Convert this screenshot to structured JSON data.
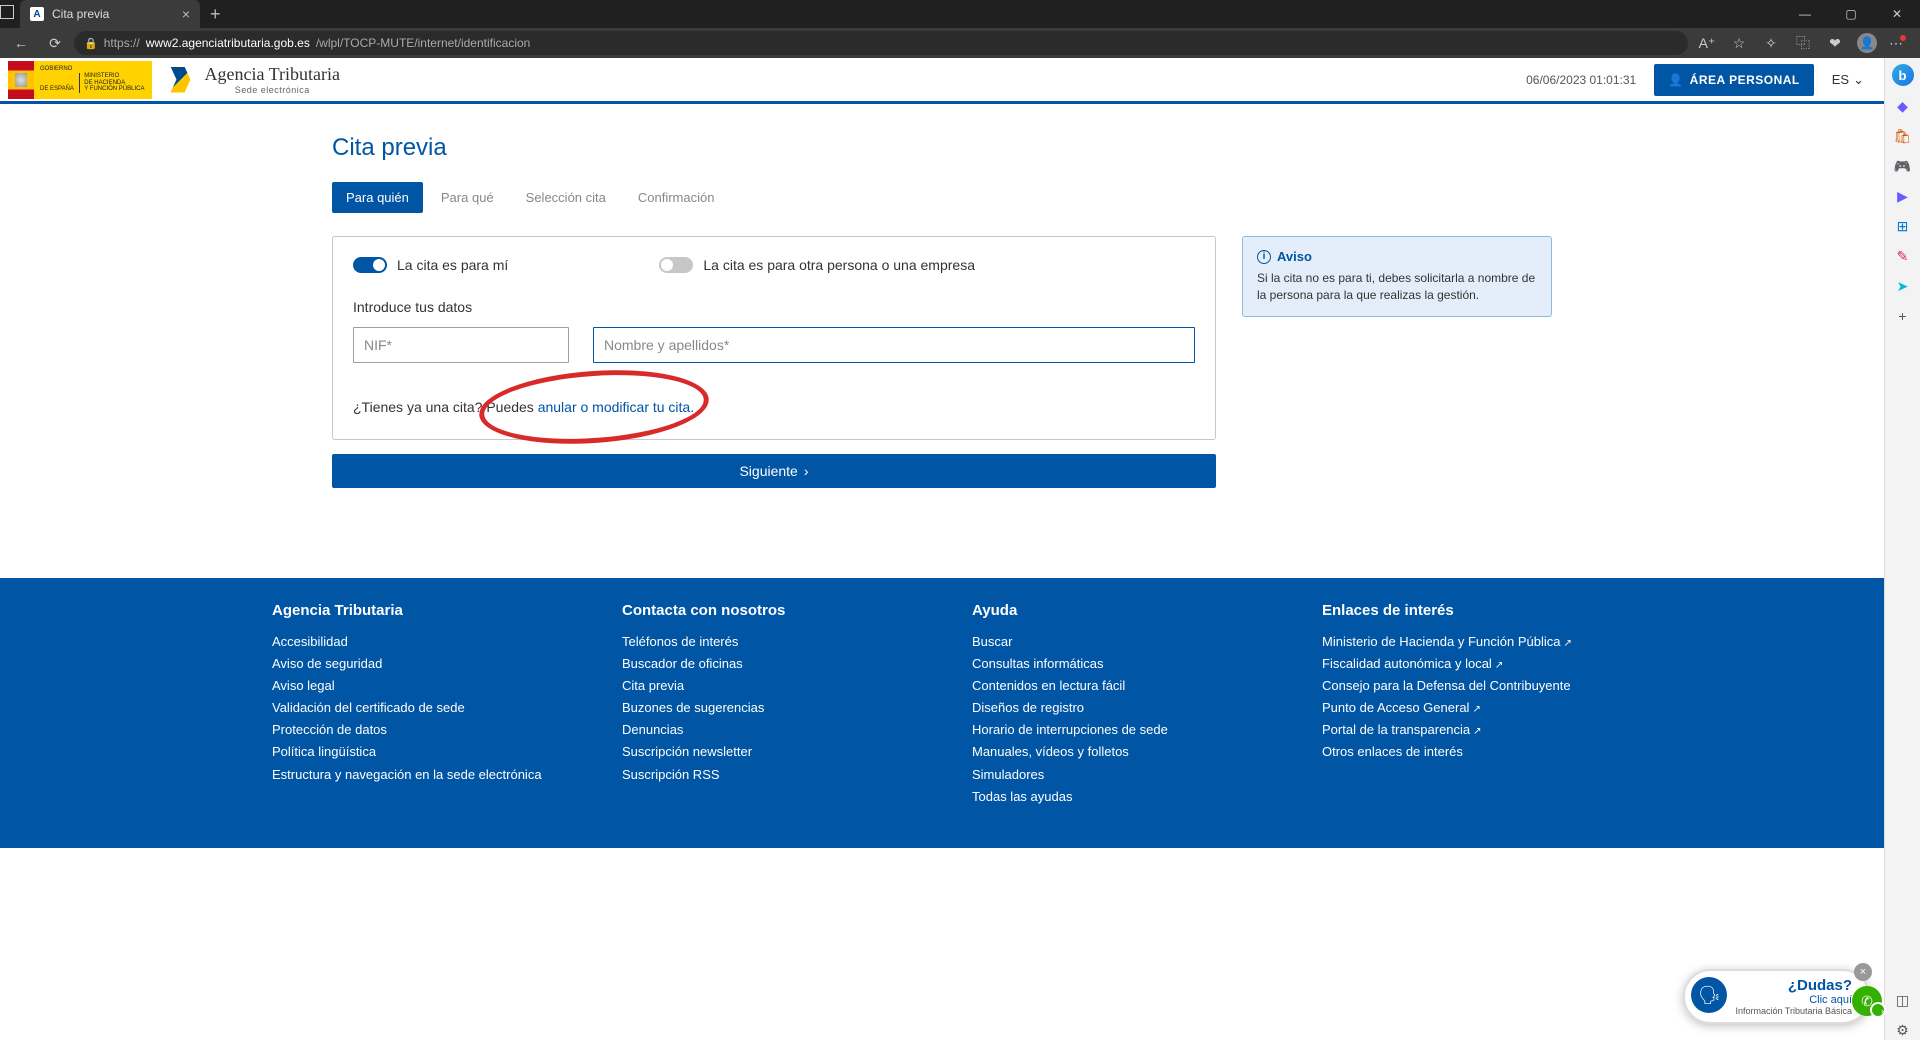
{
  "browser": {
    "tab_title": "Cita previa",
    "url_prefix": "https://",
    "url_host": "www2.agenciatributaria.gob.es",
    "url_path": "/wlpl/TOCP-MUTE/internet/identificacion"
  },
  "header": {
    "gob_line1": "GOBIERNO",
    "gob_line2": "DE ESPAÑA",
    "min_line1": "MINISTERIO",
    "min_line2": "DE HACIENDA",
    "min_line3": "Y FUNCIÓN PÚBLICA",
    "agency_name": "Agencia Tributaria",
    "agency_sub": "Sede electrónica",
    "timestamp": "06/06/2023 01:01:31",
    "area_personal": "ÁREA PERSONAL",
    "lang": "ES"
  },
  "page": {
    "title": "Cita previa",
    "tabs": [
      "Para quién",
      "Para qué",
      "Selección cita",
      "Confirmación"
    ],
    "toggle_for_me": "La cita es para mí",
    "toggle_for_other": "La cita es para otra persona o una empresa",
    "intro_label": "Introduce tus datos",
    "nif_placeholder": "NIF*",
    "name_placeholder": "Nombre y apellidos*",
    "existing_q": "¿Tienes ya una cita? ",
    "existing_p": "Puedes ",
    "existing_link": "anular o modificar tu cita.",
    "next_btn": "Siguiente"
  },
  "aviso": {
    "head": "Aviso",
    "body": "Si la cita no es para ti, debes solicitarla a nombre de la persona para la que realizas la gestión."
  },
  "footer": {
    "cols": [
      {
        "title": "Agencia Tributaria",
        "items": [
          "Accesibilidad",
          "Aviso de seguridad",
          "Aviso legal",
          "Validación del certificado de sede",
          "Protección de datos",
          "Política lingüística",
          "Estructura y navegación en la sede electrónica"
        ]
      },
      {
        "title": "Contacta con nosotros",
        "items": [
          "Teléfonos de interés",
          "Buscador de oficinas",
          "Cita previa",
          "Buzones de sugerencias",
          "Denuncias",
          "Suscripción newsletter",
          "Suscripción RSS"
        ]
      },
      {
        "title": "Ayuda",
        "items": [
          "Buscar",
          "Consultas informáticas",
          "Contenidos en lectura fácil",
          "Diseños de registro",
          "Horario de interrupciones de sede",
          "Manuales, vídeos y folletos",
          "Simuladores",
          "Todas las ayudas"
        ]
      },
      {
        "title": "Enlaces de interés",
        "items": [
          "Ministerio de Hacienda y Función Pública ↗",
          "Fiscalidad autonómica y local ↗",
          "Consejo para la Defensa del Contribuyente",
          "Punto de Acceso General ↗",
          "Portal de la transparencia ↗",
          "Otros enlaces de interés"
        ]
      }
    ]
  },
  "dudas": {
    "title": "¿Dudas?",
    "sub": "Clic aquí",
    "foot": "Información Tributaria Básica"
  }
}
